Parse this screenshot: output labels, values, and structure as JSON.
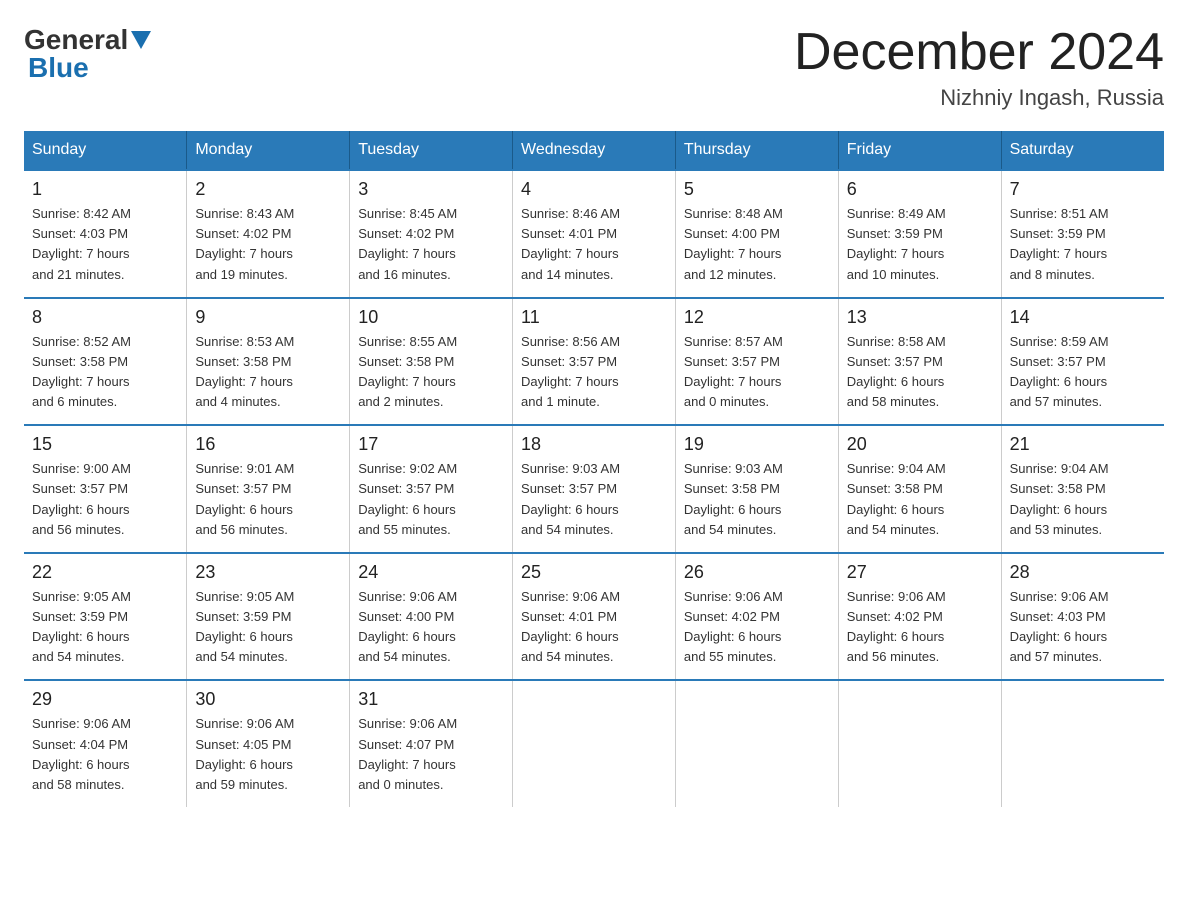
{
  "header": {
    "logo_general": "General",
    "logo_blue": "Blue",
    "title": "December 2024",
    "subtitle": "Nizhniy Ingash, Russia"
  },
  "days_of_week": [
    "Sunday",
    "Monday",
    "Tuesday",
    "Wednesday",
    "Thursday",
    "Friday",
    "Saturday"
  ],
  "weeks": [
    [
      {
        "num": "1",
        "info": "Sunrise: 8:42 AM\nSunset: 4:03 PM\nDaylight: 7 hours\nand 21 minutes."
      },
      {
        "num": "2",
        "info": "Sunrise: 8:43 AM\nSunset: 4:02 PM\nDaylight: 7 hours\nand 19 minutes."
      },
      {
        "num": "3",
        "info": "Sunrise: 8:45 AM\nSunset: 4:02 PM\nDaylight: 7 hours\nand 16 minutes."
      },
      {
        "num": "4",
        "info": "Sunrise: 8:46 AM\nSunset: 4:01 PM\nDaylight: 7 hours\nand 14 minutes."
      },
      {
        "num": "5",
        "info": "Sunrise: 8:48 AM\nSunset: 4:00 PM\nDaylight: 7 hours\nand 12 minutes."
      },
      {
        "num": "6",
        "info": "Sunrise: 8:49 AM\nSunset: 3:59 PM\nDaylight: 7 hours\nand 10 minutes."
      },
      {
        "num": "7",
        "info": "Sunrise: 8:51 AM\nSunset: 3:59 PM\nDaylight: 7 hours\nand 8 minutes."
      }
    ],
    [
      {
        "num": "8",
        "info": "Sunrise: 8:52 AM\nSunset: 3:58 PM\nDaylight: 7 hours\nand 6 minutes."
      },
      {
        "num": "9",
        "info": "Sunrise: 8:53 AM\nSunset: 3:58 PM\nDaylight: 7 hours\nand 4 minutes."
      },
      {
        "num": "10",
        "info": "Sunrise: 8:55 AM\nSunset: 3:58 PM\nDaylight: 7 hours\nand 2 minutes."
      },
      {
        "num": "11",
        "info": "Sunrise: 8:56 AM\nSunset: 3:57 PM\nDaylight: 7 hours\nand 1 minute."
      },
      {
        "num": "12",
        "info": "Sunrise: 8:57 AM\nSunset: 3:57 PM\nDaylight: 7 hours\nand 0 minutes."
      },
      {
        "num": "13",
        "info": "Sunrise: 8:58 AM\nSunset: 3:57 PM\nDaylight: 6 hours\nand 58 minutes."
      },
      {
        "num": "14",
        "info": "Sunrise: 8:59 AM\nSunset: 3:57 PM\nDaylight: 6 hours\nand 57 minutes."
      }
    ],
    [
      {
        "num": "15",
        "info": "Sunrise: 9:00 AM\nSunset: 3:57 PM\nDaylight: 6 hours\nand 56 minutes."
      },
      {
        "num": "16",
        "info": "Sunrise: 9:01 AM\nSunset: 3:57 PM\nDaylight: 6 hours\nand 56 minutes."
      },
      {
        "num": "17",
        "info": "Sunrise: 9:02 AM\nSunset: 3:57 PM\nDaylight: 6 hours\nand 55 minutes."
      },
      {
        "num": "18",
        "info": "Sunrise: 9:03 AM\nSunset: 3:57 PM\nDaylight: 6 hours\nand 54 minutes."
      },
      {
        "num": "19",
        "info": "Sunrise: 9:03 AM\nSunset: 3:58 PM\nDaylight: 6 hours\nand 54 minutes."
      },
      {
        "num": "20",
        "info": "Sunrise: 9:04 AM\nSunset: 3:58 PM\nDaylight: 6 hours\nand 54 minutes."
      },
      {
        "num": "21",
        "info": "Sunrise: 9:04 AM\nSunset: 3:58 PM\nDaylight: 6 hours\nand 53 minutes."
      }
    ],
    [
      {
        "num": "22",
        "info": "Sunrise: 9:05 AM\nSunset: 3:59 PM\nDaylight: 6 hours\nand 54 minutes."
      },
      {
        "num": "23",
        "info": "Sunrise: 9:05 AM\nSunset: 3:59 PM\nDaylight: 6 hours\nand 54 minutes."
      },
      {
        "num": "24",
        "info": "Sunrise: 9:06 AM\nSunset: 4:00 PM\nDaylight: 6 hours\nand 54 minutes."
      },
      {
        "num": "25",
        "info": "Sunrise: 9:06 AM\nSunset: 4:01 PM\nDaylight: 6 hours\nand 54 minutes."
      },
      {
        "num": "26",
        "info": "Sunrise: 9:06 AM\nSunset: 4:02 PM\nDaylight: 6 hours\nand 55 minutes."
      },
      {
        "num": "27",
        "info": "Sunrise: 9:06 AM\nSunset: 4:02 PM\nDaylight: 6 hours\nand 56 minutes."
      },
      {
        "num": "28",
        "info": "Sunrise: 9:06 AM\nSunset: 4:03 PM\nDaylight: 6 hours\nand 57 minutes."
      }
    ],
    [
      {
        "num": "29",
        "info": "Sunrise: 9:06 AM\nSunset: 4:04 PM\nDaylight: 6 hours\nand 58 minutes."
      },
      {
        "num": "30",
        "info": "Sunrise: 9:06 AM\nSunset: 4:05 PM\nDaylight: 6 hours\nand 59 minutes."
      },
      {
        "num": "31",
        "info": "Sunrise: 9:06 AM\nSunset: 4:07 PM\nDaylight: 7 hours\nand 0 minutes."
      },
      {
        "num": "",
        "info": ""
      },
      {
        "num": "",
        "info": ""
      },
      {
        "num": "",
        "info": ""
      },
      {
        "num": "",
        "info": ""
      }
    ]
  ]
}
